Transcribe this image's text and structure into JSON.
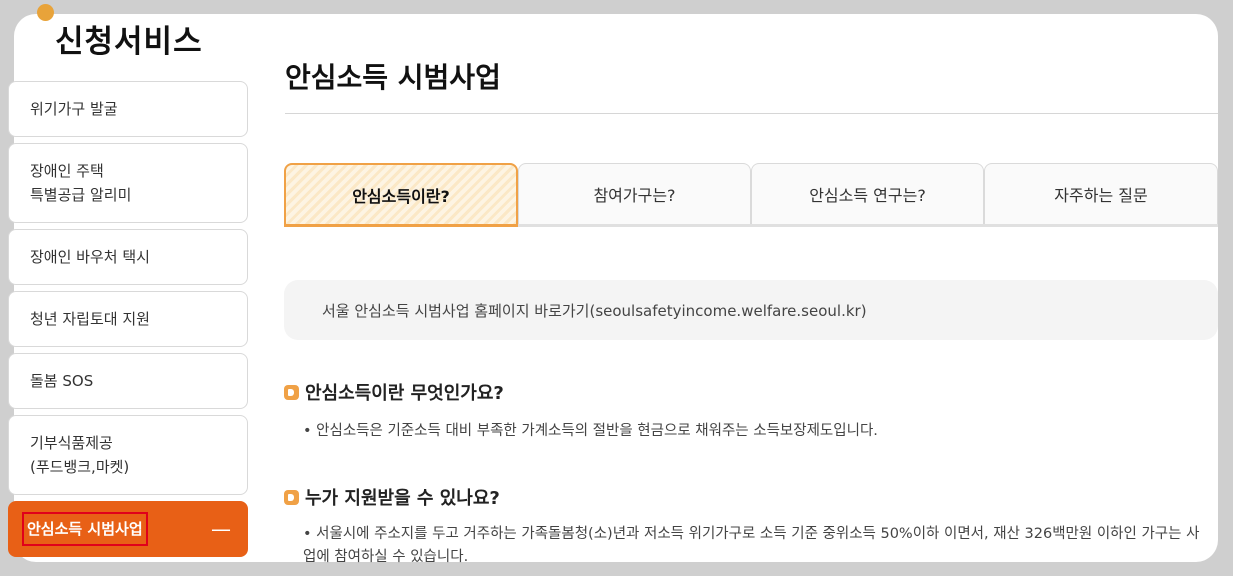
{
  "sidebar": {
    "title": "신청서비스",
    "items": [
      {
        "label": "위기가구 발굴"
      },
      {
        "label": "장애인 주택\n특별공급 알리미"
      },
      {
        "label": "장애인 바우처 택시"
      },
      {
        "label": "청년 자립토대 지원"
      },
      {
        "label": "돌봄 SOS"
      },
      {
        "label": "기부식품제공\n(푸드뱅크,마켓)"
      },
      {
        "label": "안심소득 시범사업",
        "expand_symbol": "—"
      }
    ]
  },
  "main": {
    "title": "안심소득 시범사업",
    "tabs": [
      {
        "label": "안심소득이란?"
      },
      {
        "label": "참여가구는?"
      },
      {
        "label": "안심소득 연구는?"
      },
      {
        "label": "자주하는 질문"
      }
    ],
    "homepage_link": "서울 안심소득 시범사업 홈페이지 바로가기(seoulsafetyincome.welfare.seoul.kr)",
    "sections": [
      {
        "heading": "안심소득이란 무엇인가요?",
        "body": "• 안심소득은 기준소득 대비 부족한 가계소득의 절반을 현금으로 채워주는 소득보장제도입니다."
      },
      {
        "heading": "누가 지원받을 수 있나요?",
        "body": "• 서울시에 주소지를 두고 거주하는 가족돌봄청(소)년과 저소득 위기가구로 소득 기준 중위소득 50%이하 이면서, 재산 326백만원 이하인 가구는 사업에 참여하실 수 있습니다."
      }
    ]
  },
  "colors": {
    "accent": "#e86016",
    "tab_highlight": "#f0a146",
    "background": "#cfcfcf"
  }
}
